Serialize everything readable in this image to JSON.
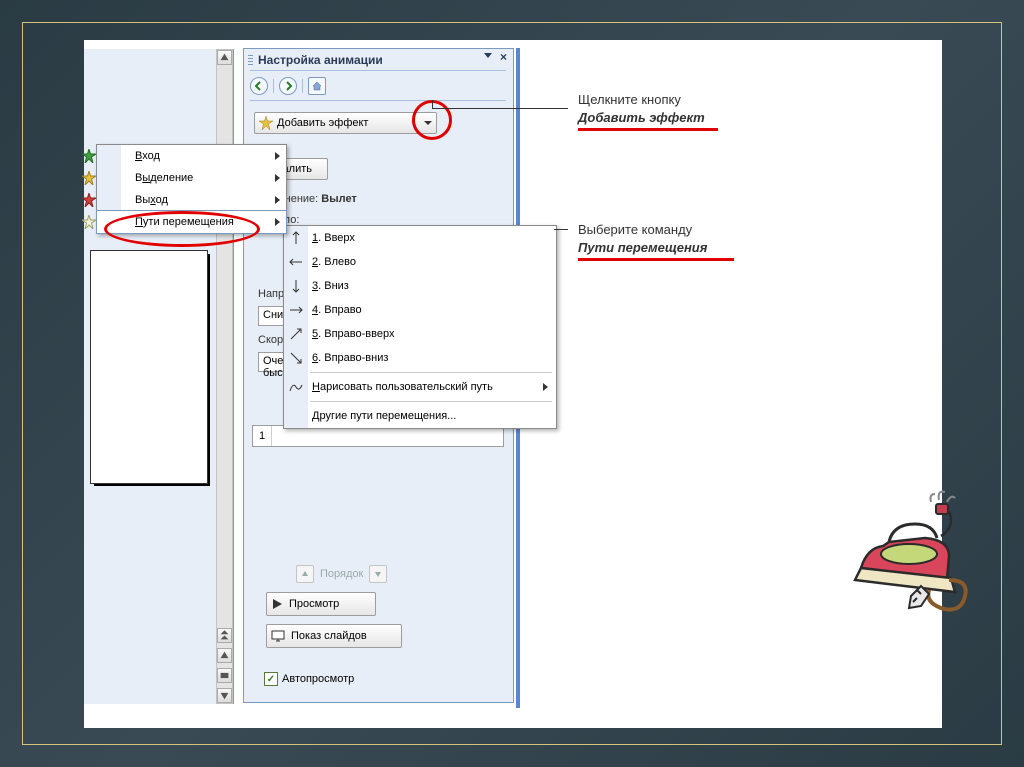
{
  "pane": {
    "title": "Настройка анимации",
    "close": "×"
  },
  "buttons": {
    "add_effect": "Добавить эффект",
    "remove": "Удалить",
    "play": "Просмотр",
    "slideshow": "Показ слайдов"
  },
  "labels": {
    "change": "Изменение:",
    "change_val": "Вылет",
    "start": "Начало:",
    "direction": "Направление:",
    "direction_val": "Снизу",
    "speed": "Скорость:",
    "speed_val": "Очень быстро",
    "order": "Порядок",
    "autopreview": "Автопросмотр"
  },
  "effect_list": {
    "num": "1"
  },
  "menu1": {
    "items": [
      "Вход",
      "Выделение",
      "Выход",
      "Пути перемещения"
    ]
  },
  "menu2": {
    "items": [
      {
        "num": "1",
        "text": "Вверх"
      },
      {
        "num": "2",
        "text": "Влево"
      },
      {
        "num": "3",
        "text": "Вниз"
      },
      {
        "num": "4",
        "text": "Вправо"
      },
      {
        "num": "5",
        "text": "Вправо-вверх"
      },
      {
        "num": "6",
        "text": "Вправо-вниз"
      }
    ],
    "custom": "Нарисовать пользовательский путь",
    "more": "Другие пути перемещения..."
  },
  "callouts": {
    "c1a": "Щелкните кнопку",
    "c1b": "Добавить эффект",
    "c2a": "Выберите команду",
    "c2b": "Пути перемещения"
  }
}
